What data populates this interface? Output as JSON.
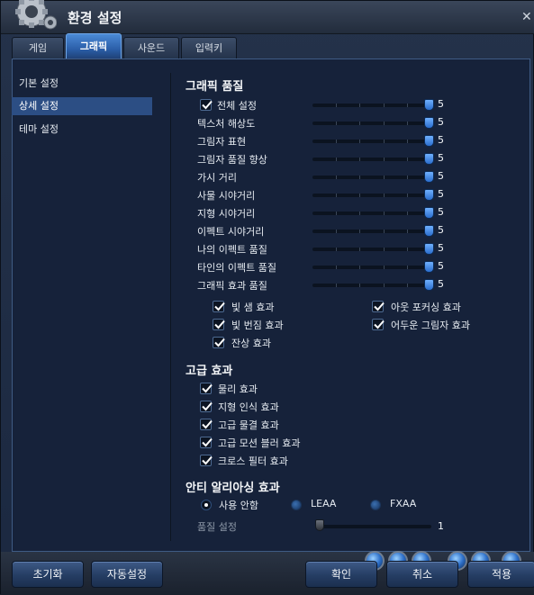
{
  "window": {
    "title": "환경 설정",
    "close_icon": "close-icon"
  },
  "tabs": [
    {
      "label": "게임",
      "active": false
    },
    {
      "label": "그래픽",
      "active": true
    },
    {
      "label": "사운드",
      "active": false
    },
    {
      "label": "입력키",
      "active": false
    }
  ],
  "sidebar": {
    "items": [
      {
        "label": "기본 설정",
        "active": false
      },
      {
        "label": "상세 설정",
        "active": true
      },
      {
        "label": "테마 설정",
        "active": false
      }
    ]
  },
  "graphics_quality": {
    "heading": "그래픽 품질",
    "rows": [
      {
        "label": "전체 설정",
        "value": "5",
        "checkbox": true,
        "checked": true
      },
      {
        "label": "텍스처 해상도",
        "value": "5"
      },
      {
        "label": "그림자 표현",
        "value": "5"
      },
      {
        "label": "그림자 품질 향상",
        "value": "5"
      },
      {
        "label": "가시 거리",
        "value": "5"
      },
      {
        "label": "사물 시야거리",
        "value": "5"
      },
      {
        "label": "지형 시야거리",
        "value": "5"
      },
      {
        "label": "이펙트 시야거리",
        "value": "5"
      },
      {
        "label": "나의 이펙트 품질",
        "value": "5"
      },
      {
        "label": "타인의 이펙트 품질",
        "value": "5"
      },
      {
        "label": "그래픽 효과 품질",
        "value": "5"
      }
    ],
    "effects_left": [
      "빛 샘 효과",
      "빛 번짐 효과",
      "잔상 효과"
    ],
    "effects_right": [
      "아웃 포커싱 효과",
      "어두운 그림자 효과"
    ]
  },
  "advanced": {
    "heading": "고급 효과",
    "items": [
      "물리 효과",
      "지형 인식 효과",
      "고급 물결 효과",
      "고급 모션 블러 효과",
      "크로스 필터 효과"
    ]
  },
  "antialiasing": {
    "heading": "안티 알리아싱 효과",
    "options": [
      {
        "label": "사용 안함",
        "selected": true
      },
      {
        "label": "LEAA",
        "selected": false
      },
      {
        "label": "FXAA",
        "selected": false
      }
    ],
    "quality_label": "품질 설정",
    "quality_value": "1"
  },
  "buttons": {
    "reset": "초기화",
    "auto": "자동설정",
    "ok": "확인",
    "cancel": "취소",
    "apply": "적용"
  },
  "colors": {
    "accent": "#2c4e84",
    "tab_active": "#3a78c8",
    "thumb": "#2a6dcc"
  }
}
